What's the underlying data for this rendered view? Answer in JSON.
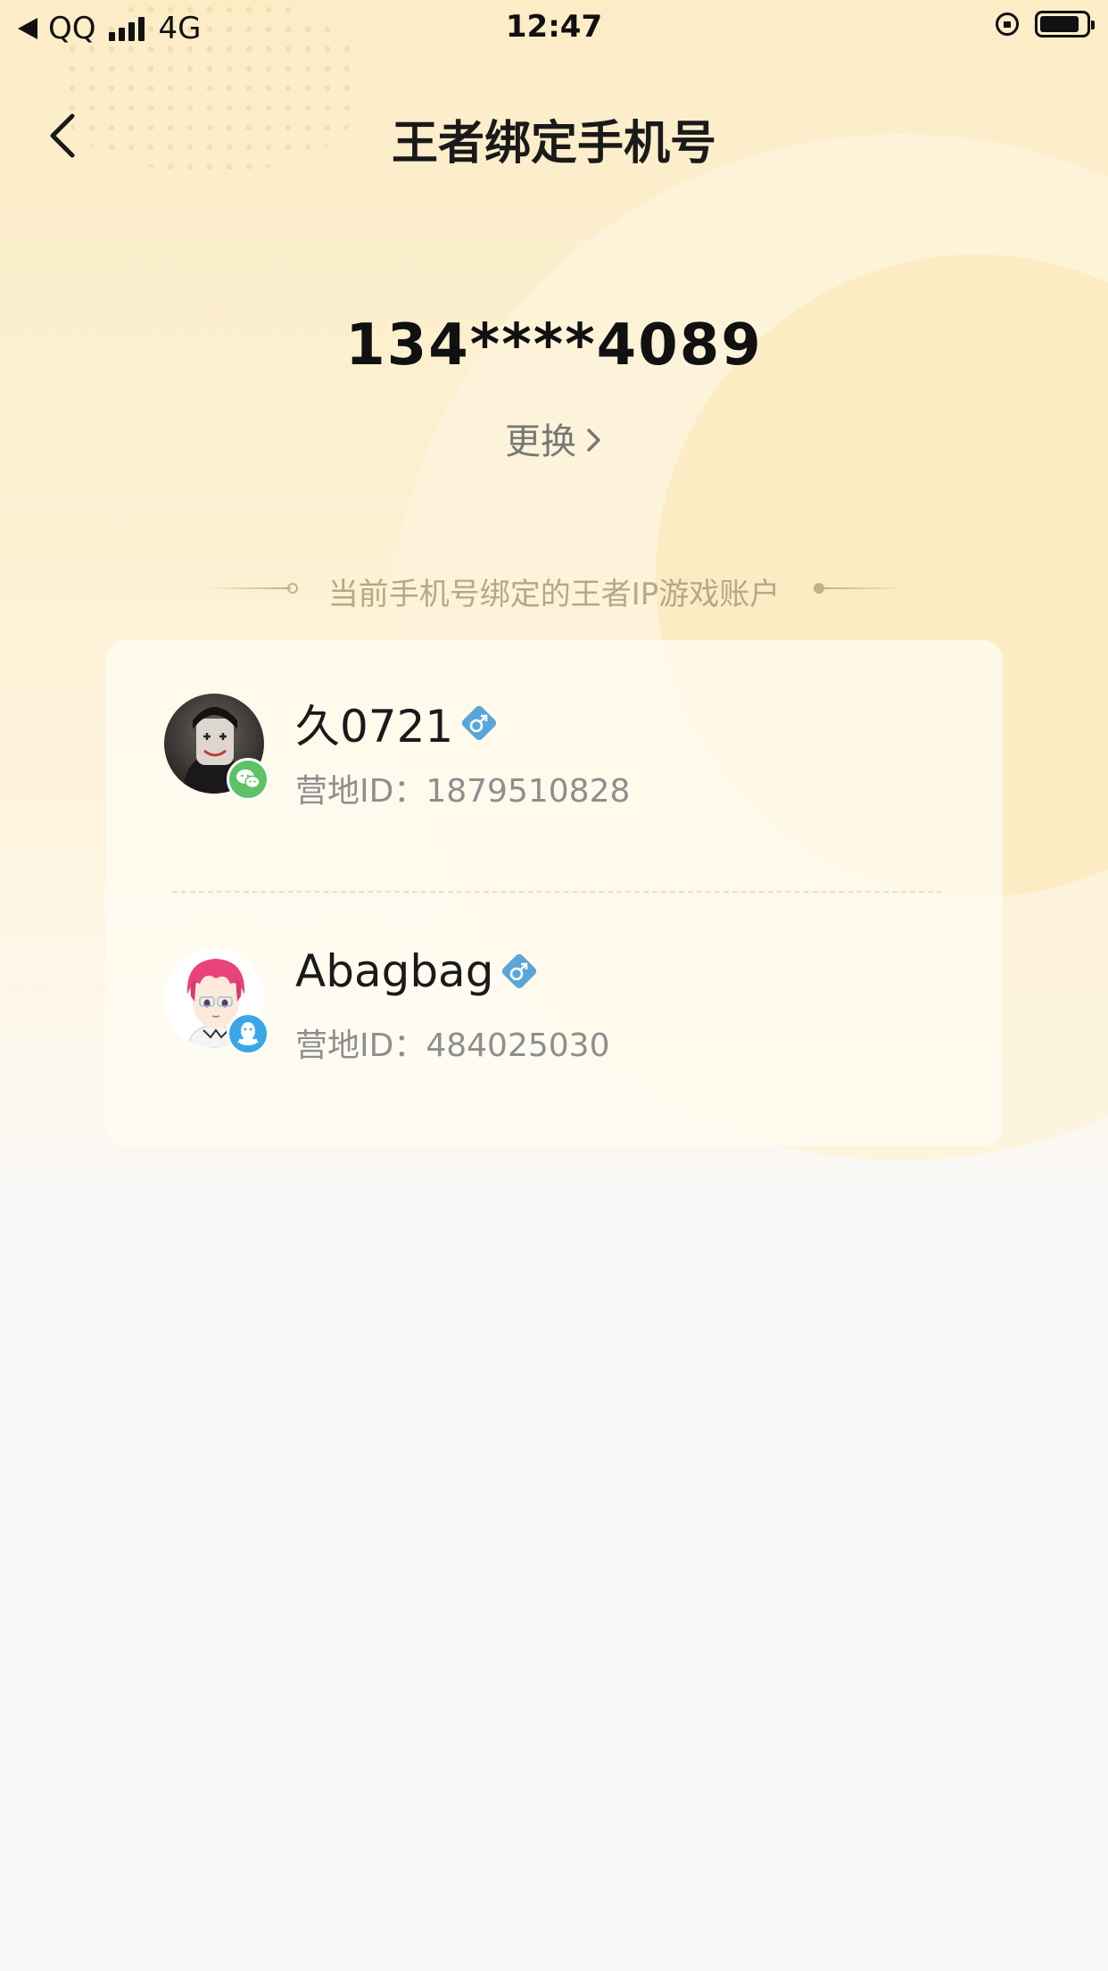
{
  "status_bar": {
    "back_app": "QQ",
    "network": "4G",
    "time": "12:47",
    "battery_level": 0.85
  },
  "nav": {
    "title": "王者绑定手机号"
  },
  "phone": {
    "number": "134****4089",
    "change_label": "更换"
  },
  "section": {
    "label": "当前手机号绑定的王者IP游戏账户"
  },
  "accounts": [
    {
      "name": "久0721",
      "gender_icon": "male-icon",
      "id_label": "营地ID：",
      "id_value": "1879510828",
      "platform_icon": "wechat-icon"
    },
    {
      "name": "Abagbag",
      "gender_icon": "male-icon",
      "id_label": "营地ID：",
      "id_value": "484025030",
      "platform_icon": "qq-icon"
    }
  ],
  "colors": {
    "background_top": "#fcedc7",
    "background_bottom": "#f9f9fb",
    "gender_badge": "#5aa6d8",
    "wechat_green": "#5ec266",
    "qq_blue": "#3aa6e8",
    "section_gold": "#b6a888"
  }
}
